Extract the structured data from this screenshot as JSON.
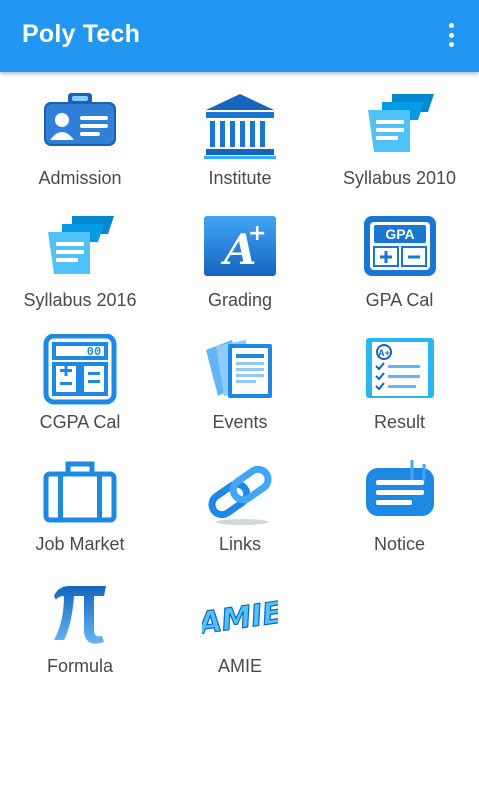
{
  "app": {
    "title": "Poly Tech",
    "menu_icon": "more-vert-icon"
  },
  "menu": [
    {
      "id": "admission",
      "label": "Admission",
      "icon": "id-card-icon"
    },
    {
      "id": "institute",
      "label": "Institute",
      "icon": "institute-building-icon"
    },
    {
      "id": "syllabus-2010",
      "label": "Syllabus 2010",
      "icon": "syllabus-documents-icon"
    },
    {
      "id": "syllabus-2016",
      "label": "Syllabus 2016",
      "icon": "syllabus-documents-icon"
    },
    {
      "id": "grading",
      "label": "Grading",
      "icon": "a-plus-grade-icon"
    },
    {
      "id": "gpa-cal",
      "label": "GPA Cal",
      "icon": "gpa-calculator-icon",
      "icon_text": "GPA"
    },
    {
      "id": "cgpa-cal",
      "label": "CGPA Cal",
      "icon": "calculator-icon",
      "icon_text": "00"
    },
    {
      "id": "events",
      "label": "Events",
      "icon": "events-documents-icon"
    },
    {
      "id": "result",
      "label": "Result",
      "icon": "result-checklist-icon"
    },
    {
      "id": "job-market",
      "label": "Job Market",
      "icon": "briefcase-icon"
    },
    {
      "id": "links",
      "label": "Links",
      "icon": "chain-link-icon"
    },
    {
      "id": "notice",
      "label": "Notice",
      "icon": "notice-clip-icon"
    },
    {
      "id": "formula",
      "label": "Formula",
      "icon": "pi-icon"
    },
    {
      "id": "amie",
      "label": "AMIE",
      "icon": "amie-logo-icon",
      "icon_text": "AMIE"
    }
  ],
  "colors": {
    "appbar": "#2196F3",
    "icon_blue": "#1E88E5",
    "icon_light": "#4FC3F7",
    "label": "#4a4a4a"
  }
}
